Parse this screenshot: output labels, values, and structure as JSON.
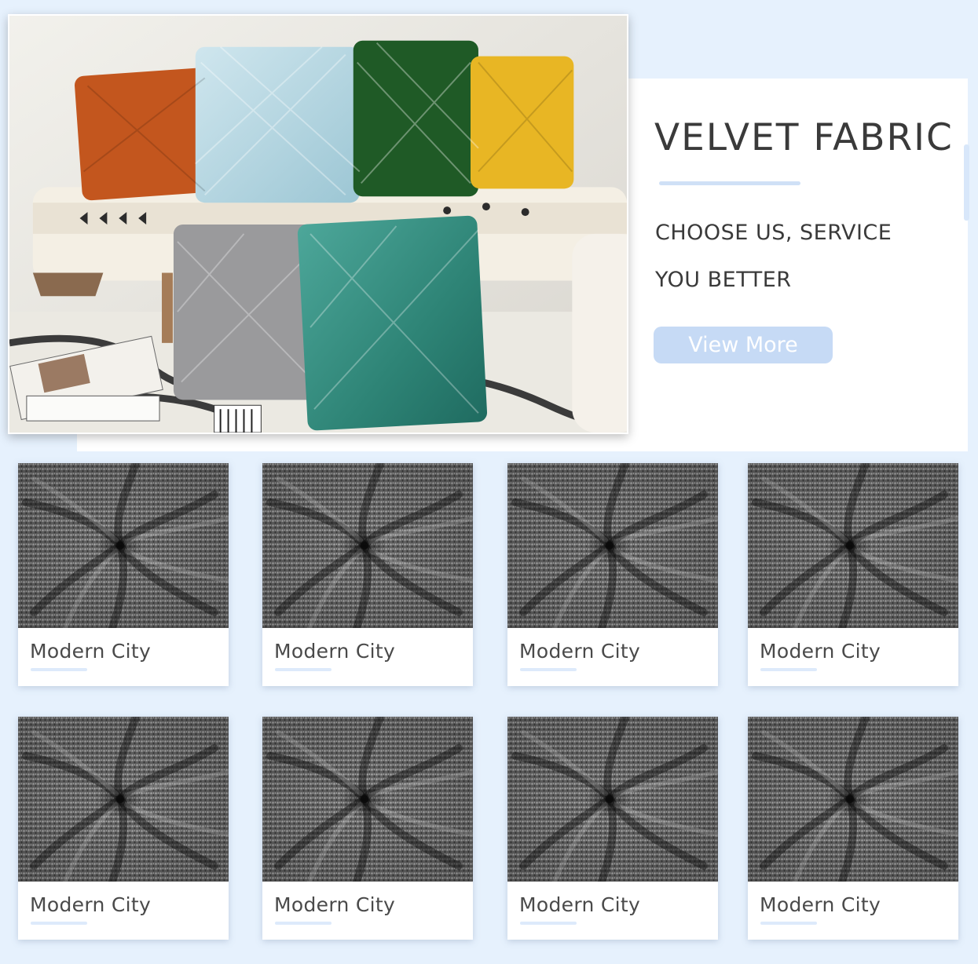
{
  "hero": {
    "title": "VELVET FABRIC",
    "tagline_line1": "CHOOSE US, SERVICE",
    "tagline_line2": "YOU BETTER",
    "button_label": "View More"
  },
  "products": [
    {
      "name": "Modern City"
    },
    {
      "name": "Modern City"
    },
    {
      "name": "Modern City"
    },
    {
      "name": "Modern City"
    },
    {
      "name": "Modern City"
    },
    {
      "name": "Modern City"
    },
    {
      "name": "Modern City"
    },
    {
      "name": "Modern City"
    }
  ],
  "colors": {
    "page_background": "#e6f1fd",
    "button": "#c6daf5",
    "accent_rule": "#cfe0f6",
    "text": "#3a3a3a"
  }
}
